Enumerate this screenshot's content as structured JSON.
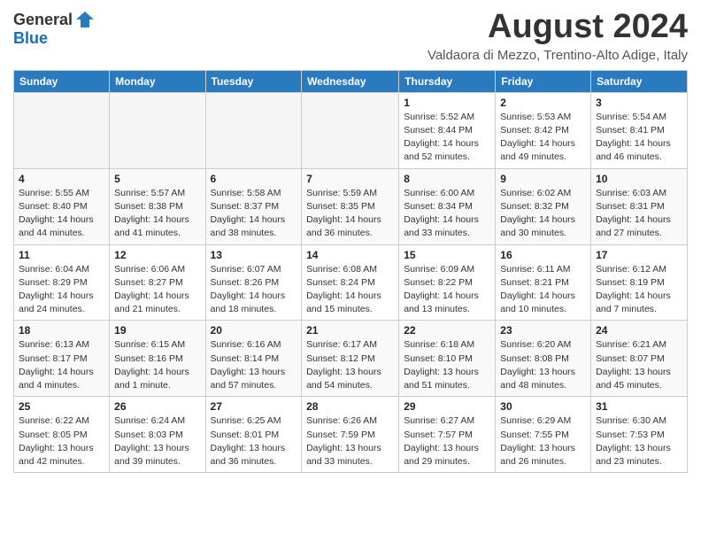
{
  "header": {
    "logo_general": "General",
    "logo_blue": "Blue",
    "month_year": "August 2024",
    "location": "Valdaora di Mezzo, Trentino-Alto Adige, Italy"
  },
  "days_of_week": [
    "Sunday",
    "Monday",
    "Tuesday",
    "Wednesday",
    "Thursday",
    "Friday",
    "Saturday"
  ],
  "weeks": [
    [
      {
        "day": "",
        "info": ""
      },
      {
        "day": "",
        "info": ""
      },
      {
        "day": "",
        "info": ""
      },
      {
        "day": "",
        "info": ""
      },
      {
        "day": "1",
        "info": "Sunrise: 5:52 AM\nSunset: 8:44 PM\nDaylight: 14 hours and 52 minutes."
      },
      {
        "day": "2",
        "info": "Sunrise: 5:53 AM\nSunset: 8:42 PM\nDaylight: 14 hours and 49 minutes."
      },
      {
        "day": "3",
        "info": "Sunrise: 5:54 AM\nSunset: 8:41 PM\nDaylight: 14 hours and 46 minutes."
      }
    ],
    [
      {
        "day": "4",
        "info": "Sunrise: 5:55 AM\nSunset: 8:40 PM\nDaylight: 14 hours and 44 minutes."
      },
      {
        "day": "5",
        "info": "Sunrise: 5:57 AM\nSunset: 8:38 PM\nDaylight: 14 hours and 41 minutes."
      },
      {
        "day": "6",
        "info": "Sunrise: 5:58 AM\nSunset: 8:37 PM\nDaylight: 14 hours and 38 minutes."
      },
      {
        "day": "7",
        "info": "Sunrise: 5:59 AM\nSunset: 8:35 PM\nDaylight: 14 hours and 36 minutes."
      },
      {
        "day": "8",
        "info": "Sunrise: 6:00 AM\nSunset: 8:34 PM\nDaylight: 14 hours and 33 minutes."
      },
      {
        "day": "9",
        "info": "Sunrise: 6:02 AM\nSunset: 8:32 PM\nDaylight: 14 hours and 30 minutes."
      },
      {
        "day": "10",
        "info": "Sunrise: 6:03 AM\nSunset: 8:31 PM\nDaylight: 14 hours and 27 minutes."
      }
    ],
    [
      {
        "day": "11",
        "info": "Sunrise: 6:04 AM\nSunset: 8:29 PM\nDaylight: 14 hours and 24 minutes."
      },
      {
        "day": "12",
        "info": "Sunrise: 6:06 AM\nSunset: 8:27 PM\nDaylight: 14 hours and 21 minutes."
      },
      {
        "day": "13",
        "info": "Sunrise: 6:07 AM\nSunset: 8:26 PM\nDaylight: 14 hours and 18 minutes."
      },
      {
        "day": "14",
        "info": "Sunrise: 6:08 AM\nSunset: 8:24 PM\nDaylight: 14 hours and 15 minutes."
      },
      {
        "day": "15",
        "info": "Sunrise: 6:09 AM\nSunset: 8:22 PM\nDaylight: 14 hours and 13 minutes."
      },
      {
        "day": "16",
        "info": "Sunrise: 6:11 AM\nSunset: 8:21 PM\nDaylight: 14 hours and 10 minutes."
      },
      {
        "day": "17",
        "info": "Sunrise: 6:12 AM\nSunset: 8:19 PM\nDaylight: 14 hours and 7 minutes."
      }
    ],
    [
      {
        "day": "18",
        "info": "Sunrise: 6:13 AM\nSunset: 8:17 PM\nDaylight: 14 hours and 4 minutes."
      },
      {
        "day": "19",
        "info": "Sunrise: 6:15 AM\nSunset: 8:16 PM\nDaylight: 14 hours and 1 minute."
      },
      {
        "day": "20",
        "info": "Sunrise: 6:16 AM\nSunset: 8:14 PM\nDaylight: 13 hours and 57 minutes."
      },
      {
        "day": "21",
        "info": "Sunrise: 6:17 AM\nSunset: 8:12 PM\nDaylight: 13 hours and 54 minutes."
      },
      {
        "day": "22",
        "info": "Sunrise: 6:18 AM\nSunset: 8:10 PM\nDaylight: 13 hours and 51 minutes."
      },
      {
        "day": "23",
        "info": "Sunrise: 6:20 AM\nSunset: 8:08 PM\nDaylight: 13 hours and 48 minutes."
      },
      {
        "day": "24",
        "info": "Sunrise: 6:21 AM\nSunset: 8:07 PM\nDaylight: 13 hours and 45 minutes."
      }
    ],
    [
      {
        "day": "25",
        "info": "Sunrise: 6:22 AM\nSunset: 8:05 PM\nDaylight: 13 hours and 42 minutes."
      },
      {
        "day": "26",
        "info": "Sunrise: 6:24 AM\nSunset: 8:03 PM\nDaylight: 13 hours and 39 minutes."
      },
      {
        "day": "27",
        "info": "Sunrise: 6:25 AM\nSunset: 8:01 PM\nDaylight: 13 hours and 36 minutes."
      },
      {
        "day": "28",
        "info": "Sunrise: 6:26 AM\nSunset: 7:59 PM\nDaylight: 13 hours and 33 minutes."
      },
      {
        "day": "29",
        "info": "Sunrise: 6:27 AM\nSunset: 7:57 PM\nDaylight: 13 hours and 29 minutes."
      },
      {
        "day": "30",
        "info": "Sunrise: 6:29 AM\nSunset: 7:55 PM\nDaylight: 13 hours and 26 minutes."
      },
      {
        "day": "31",
        "info": "Sunrise: 6:30 AM\nSunset: 7:53 PM\nDaylight: 13 hours and 23 minutes."
      }
    ]
  ]
}
